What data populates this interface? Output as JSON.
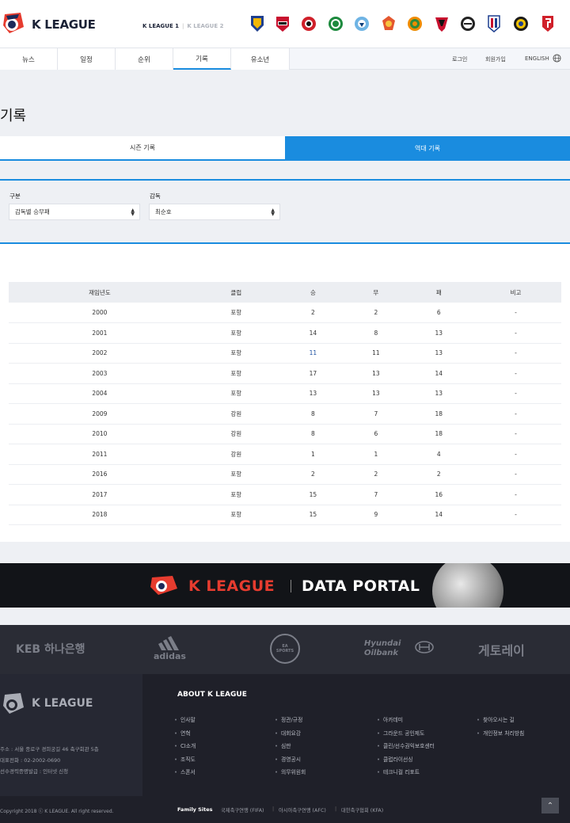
{
  "header": {
    "logo_text": "K LEAGUE",
    "league1": "K LEAGUE 1",
    "league2": "K LEAGUE 2",
    "clubs": [
      "ulsan-emblem",
      "seoul-emblem",
      "pohang-emblem",
      "jeonbuk-emblem",
      "daegu-emblem",
      "gangwon-emblem",
      "jeju-emblem",
      "sangju-emblem",
      "suwon-emblem",
      "incheon-emblem",
      "gyeongnam-emblem",
      "extra-emblem"
    ]
  },
  "nav": {
    "tabs": [
      "뉴스",
      "일정",
      "순위",
      "기록",
      "유소년"
    ],
    "login": "로그인",
    "signup": "회원가입",
    "english": "ENGLISH"
  },
  "page_title": "기록",
  "subtabs": [
    "시즌 기록",
    "역대 기록"
  ],
  "filter": {
    "label_category": "구분",
    "label_coach": "감독",
    "category_value": "감독별 승무패",
    "coach_value": "최순호"
  },
  "table": {
    "headers": [
      "재임년도",
      "클럽",
      "승",
      "무",
      "패",
      "비고"
    ],
    "rows": [
      [
        "2000",
        "포항",
        "2",
        "2",
        "6",
        "-"
      ],
      [
        "2001",
        "포항",
        "14",
        "8",
        "13",
        "-"
      ],
      [
        "2002",
        "포항",
        "11",
        "11",
        "13",
        "-"
      ],
      [
        "2003",
        "포항",
        "17",
        "13",
        "14",
        "-"
      ],
      [
        "2004",
        "포항",
        "13",
        "13",
        "13",
        "-"
      ],
      [
        "2009",
        "강원",
        "8",
        "7",
        "18",
        "-"
      ],
      [
        "2010",
        "강원",
        "8",
        "6",
        "18",
        "-"
      ],
      [
        "2011",
        "강원",
        "1",
        "1",
        "4",
        "-"
      ],
      [
        "2016",
        "포항",
        "2",
        "2",
        "2",
        "-"
      ],
      [
        "2017",
        "포항",
        "15",
        "7",
        "16",
        "-"
      ],
      [
        "2018",
        "포항",
        "15",
        "9",
        "14",
        "-"
      ]
    ]
  },
  "banner": {
    "part1": "K LEAGUE",
    "part2": "DATA PORTAL"
  },
  "sponsors": [
    "KEB 하나은행",
    "adidas",
    "EA SPORTS",
    "Hyundai Oilbank",
    "게토레이"
  ],
  "footer": {
    "logo_text": "K LEAGUE",
    "address": "주소 : 서울 종로구 경희궁길 46 축구회관 5층",
    "phone": "대표전화 : 02-2002-0690",
    "cert": "선수경력증명발급 : 인터넷 신청",
    "about_title": "ABOUT K LEAGUE",
    "links": [
      [
        "인사말",
        "연혁",
        "CI소개",
        "조직도",
        "스폰서"
      ],
      [
        "정관/규정",
        "대회요강",
        "심판",
        "경영공시",
        "의무위원회"
      ],
      [
        "아카데미",
        "그라운드 공인제도",
        "클린/선수권익보호센터",
        "클럽라이선싱",
        "테크니컬 리포트"
      ],
      [
        "찾아오시는 길",
        "개인정보 처리방침"
      ]
    ],
    "copyright": "Copyright 2018 ⓒ K LEAGUE. All right reserved.",
    "family_label": "Family Sites",
    "family_sites": [
      "국제축구연맹 (FIFA)",
      "아시아축구연맹 (AFC)",
      "대한축구협회 (KFA)"
    ]
  },
  "colors": {
    "accent": "#1a8cdf",
    "brand_red": "#e63c2f",
    "dark": "#1f2029"
  }
}
